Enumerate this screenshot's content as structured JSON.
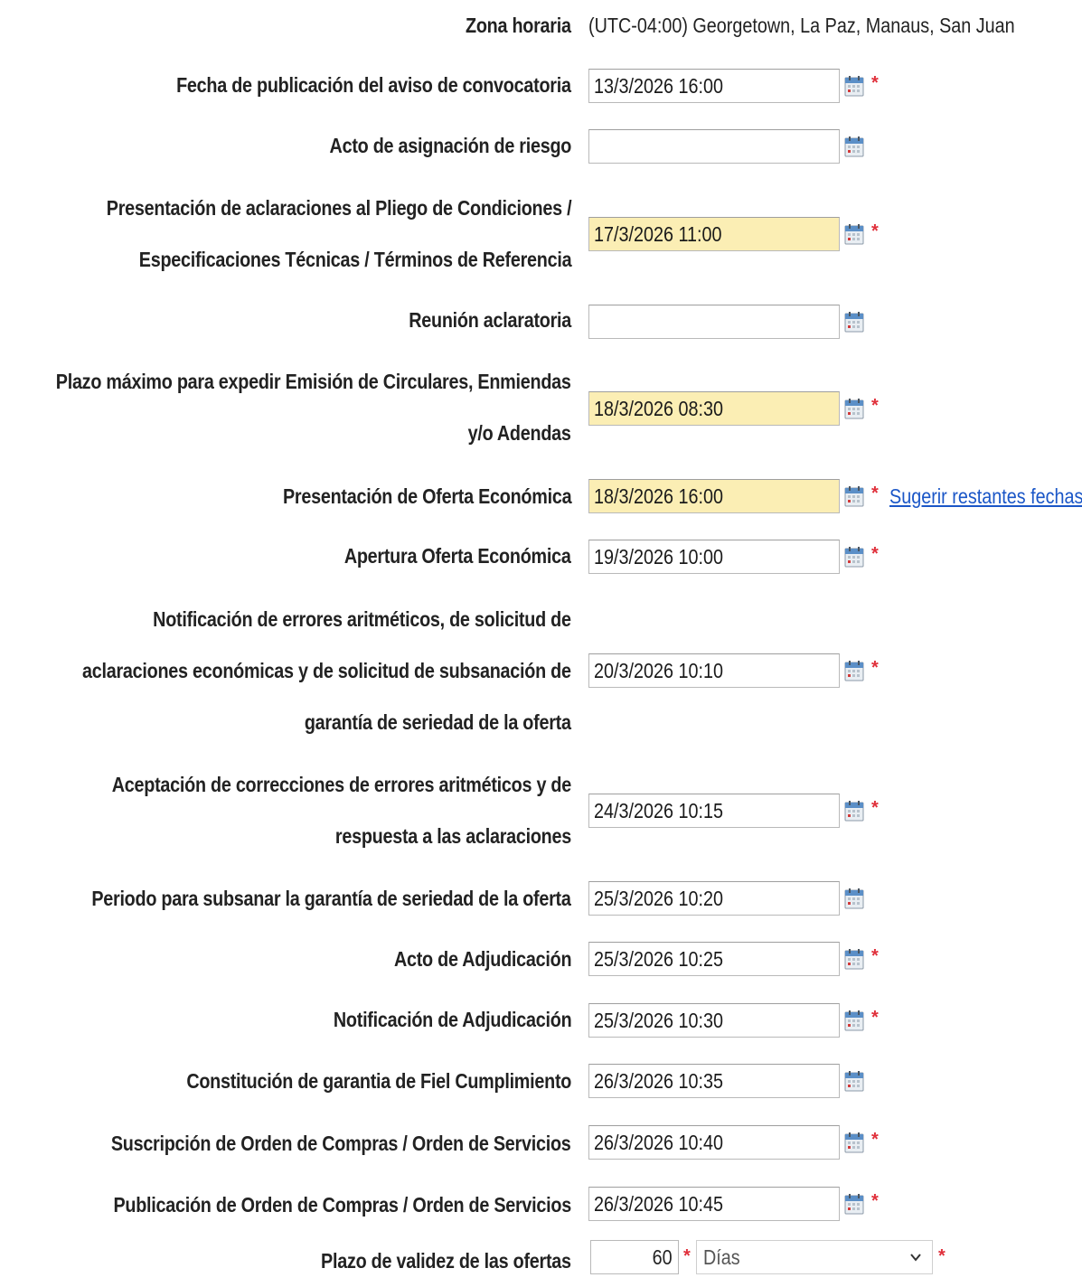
{
  "timezone": {
    "label": "Zona horaria",
    "value": "(UTC-04:00) Georgetown, La Paz, Manaus, San Juan"
  },
  "rows": [
    {
      "label": [
        "Fecha de publicación del aviso de convocatoria"
      ],
      "value": "13/3/2026 16:00",
      "required": true,
      "highlighted": false
    },
    {
      "label": [
        "Acto de asignación de riesgo"
      ],
      "value": "",
      "required": false,
      "highlighted": false
    },
    {
      "label": [
        "Presentación de aclaraciones al Pliego de Condiciones /",
        "Especificaciones Técnicas / Términos de Referencia"
      ],
      "value": "17/3/2026 11:00",
      "required": true,
      "highlighted": true
    },
    {
      "label": [
        "Reunión aclaratoria"
      ],
      "value": "",
      "required": false,
      "highlighted": false
    },
    {
      "label": [
        "Plazo máximo para expedir Emisión de Circulares, Enmiendas",
        "y/o Adendas"
      ],
      "value": "18/3/2026 08:30",
      "required": true,
      "highlighted": true
    },
    {
      "label": [
        "Presentación de Oferta Económica"
      ],
      "value": "18/3/2026 16:00",
      "required": true,
      "highlighted": true
    },
    {
      "label": [
        "Apertura Oferta Económica"
      ],
      "value": "19/3/2026 10:00",
      "required": true,
      "highlighted": false
    },
    {
      "label": [
        "Notificación de errores aritméticos, de solicitud de",
        "aclaraciones económicas y de solicitud de subsanación de",
        "garantía de seriedad de la oferta"
      ],
      "value": "20/3/2026 10:10",
      "required": true,
      "highlighted": false
    },
    {
      "label": [
        "Aceptación de correcciones de errores aritméticos y de",
        "respuesta a las aclaraciones"
      ],
      "value": "24/3/2026 10:15",
      "required": true,
      "highlighted": false
    },
    {
      "label": [
        "Periodo para subsanar la garantía de seriedad de la oferta"
      ],
      "value": "25/3/2026 10:20",
      "required": false,
      "highlighted": false
    },
    {
      "label": [
        "Acto de Adjudicación"
      ],
      "value": "25/3/2026 10:25",
      "required": true,
      "highlighted": false
    },
    {
      "label": [
        "Notificación de Adjudicación"
      ],
      "value": "25/3/2026 10:30",
      "required": true,
      "highlighted": false
    },
    {
      "label": [
        "Constitución de garantia de Fiel Cumplimiento"
      ],
      "value": "26/3/2026 10:35",
      "required": false,
      "highlighted": false
    },
    {
      "label": [
        "Suscripción de Orden de Compras / Orden de Servicios"
      ],
      "value": "26/3/2026 10:40",
      "required": true,
      "highlighted": false
    },
    {
      "label": [
        "Publicación de Orden de Compras / Orden de Servicios"
      ],
      "value": "26/3/2026 10:45",
      "required": true,
      "highlighted": false
    }
  ],
  "suggest_link": "Sugerir restantes fechas",
  "validity": {
    "label": "Plazo de validez de las ofertas",
    "amount": "60",
    "unit": "Días"
  },
  "required_marker": "*",
  "icons": {
    "calendar": "calendar-icon",
    "dropdown": "chevron-down-icon"
  },
  "colors": {
    "highlight": "#fbeeb4",
    "required": "#e0303b",
    "link": "#1a56c7"
  }
}
